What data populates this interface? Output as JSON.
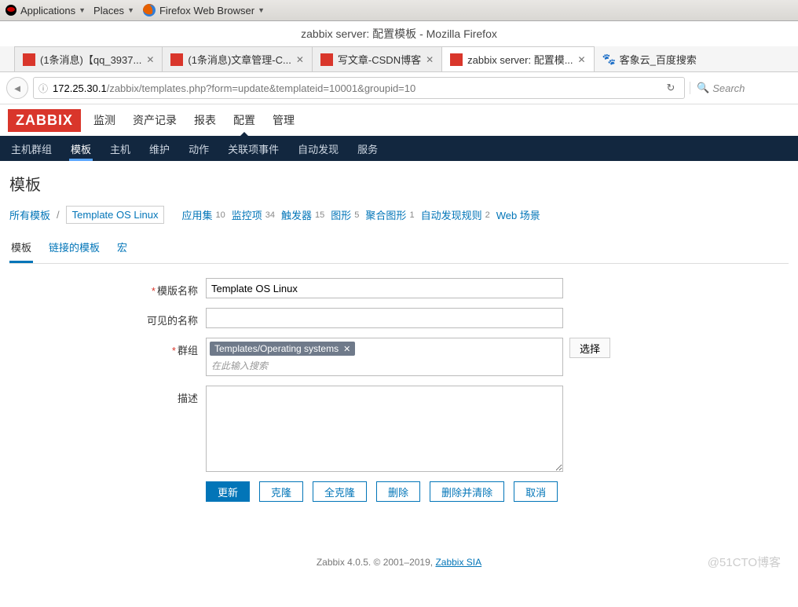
{
  "gnome": {
    "applications": "Applications",
    "places": "Places",
    "firefox": "Firefox Web Browser"
  },
  "window_title": "zabbix server: 配置模板 - Mozilla Firefox",
  "browser_tabs": [
    {
      "label": "(1条消息)【qq_3937...",
      "icon": "csdn"
    },
    {
      "label": "(1条消息)文章管理-C...",
      "icon": "csdn"
    },
    {
      "label": "写文章-CSDN博客",
      "icon": "csdn"
    },
    {
      "label": "zabbix server: 配置模...",
      "icon": "zabbix",
      "active": true
    },
    {
      "label": "客象云_百度搜索",
      "icon": "paw",
      "noclose": true
    }
  ],
  "url": {
    "info": "ⓘ",
    "host": "172.25.30.1",
    "path": "/zabbix/templates.php?form=update&templateid=10001&groupid=10",
    "search_placeholder": "Search"
  },
  "zabbix": {
    "logo": "ZABBIX",
    "mainnav": [
      {
        "label": "监测"
      },
      {
        "label": "资产记录"
      },
      {
        "label": "报表"
      },
      {
        "label": "配置",
        "active": true
      },
      {
        "label": "管理"
      }
    ],
    "subnav": [
      {
        "label": "主机群组"
      },
      {
        "label": "模板",
        "active": true
      },
      {
        "label": "主机"
      },
      {
        "label": "维护"
      },
      {
        "label": "动作"
      },
      {
        "label": "关联项事件"
      },
      {
        "label": "自动发现"
      },
      {
        "label": "服务"
      }
    ]
  },
  "page": {
    "title": "模板",
    "breadcrumb": {
      "all": "所有模板",
      "current": "Template OS Linux",
      "items": [
        {
          "label": "应用集",
          "count": "10"
        },
        {
          "label": "监控项",
          "count": "34"
        },
        {
          "label": "触发器",
          "count": "15"
        },
        {
          "label": "图形",
          "count": "5"
        },
        {
          "label": "聚合图形",
          "count": "1"
        },
        {
          "label": "自动发现规则",
          "count": "2"
        },
        {
          "label": "Web 场景",
          "count": ""
        }
      ]
    },
    "form_tabs": [
      {
        "label": "模板",
        "active": true
      },
      {
        "label": "链接的模板"
      },
      {
        "label": "宏"
      }
    ],
    "form": {
      "name_label": "模版名称",
      "name_value": "Template OS Linux",
      "visible_label": "可见的名称",
      "visible_value": "",
      "group_label": "群组",
      "group_tag": "Templates/Operating systems",
      "group_placeholder": "在此输入搜索",
      "select_label": "选择",
      "desc_label": "描述",
      "desc_value": ""
    },
    "buttons": {
      "update": "更新",
      "clone": "克隆",
      "fullclone": "全克隆",
      "delete": "删除",
      "delete_clear": "删除并清除",
      "cancel": "取消"
    }
  },
  "footer": {
    "text": "Zabbix 4.0.5. © 2001–2019, ",
    "link": "Zabbix SIA",
    "watermark": "@51CTO博客"
  }
}
